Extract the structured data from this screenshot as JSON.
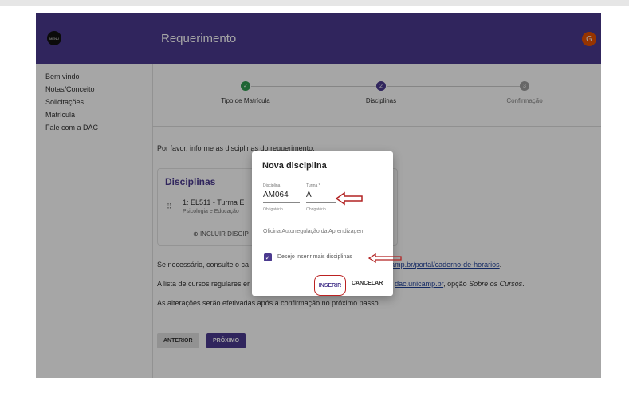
{
  "header": {
    "title": "Requerimento",
    "avatar_initial": "G",
    "logo_text": "MENU"
  },
  "sidebar": {
    "items": [
      {
        "label": "Bem vindo"
      },
      {
        "label": "Notas/Conceito"
      },
      {
        "label": "Solicitações"
      },
      {
        "label": "Matrícula"
      },
      {
        "label": "Fale com a DAC"
      }
    ]
  },
  "stepper": {
    "steps": [
      {
        "label": "Tipo de Matrícula",
        "state": "done",
        "marker": "✓"
      },
      {
        "label": "Disciplinas",
        "state": "active",
        "marker": "2"
      },
      {
        "label": "Confirmação",
        "state": "pending",
        "marker": "3"
      }
    ]
  },
  "main": {
    "intro": "Por favor, informe as disciplinas do requerimento.",
    "card": {
      "title": "Disciplinas",
      "item_title": "1: EL511 - Turma E",
      "item_subtitle": "Psicologia e Educação",
      "add_label": "INCLUIR DISCIP"
    },
    "note1_prefix": "Se necessário, consulte o ca",
    "note1_link": "amp.br/portal/caderno-de-horarios",
    "note1_suffix": ".",
    "note2_prefix": "A lista de cursos regulares er",
    "note2_link": "dac.unicamp.br",
    "note2_mid": ", opção ",
    "note2_italic": "Sobre os Cursos",
    "note2_end": ".",
    "note3": "As alterações serão efetivadas após a confirmação no próximo passo.",
    "btn_prev": "ANTERIOR",
    "btn_next": "PRÓXIMO"
  },
  "dialog": {
    "title": "Nova disciplina",
    "disciplina_label": "Disciplina",
    "disciplina_value": "AM064",
    "disciplina_hint": "Obrigatório",
    "turma_label": "Turma *",
    "turma_value": "A",
    "turma_hint": "Obrigatório",
    "description": "Oficina Autorregulação da Aprendizagem",
    "checkbox_label": "Desejo inserir mais disciplinas",
    "checkbox_checked": true,
    "insert_label": "INSERIR",
    "cancel_label": "CANCELAR"
  },
  "colors": {
    "primary": "#4b3a8f",
    "success": "#2e9b4f",
    "avatar": "#e65100",
    "annotation": "#b22222"
  }
}
